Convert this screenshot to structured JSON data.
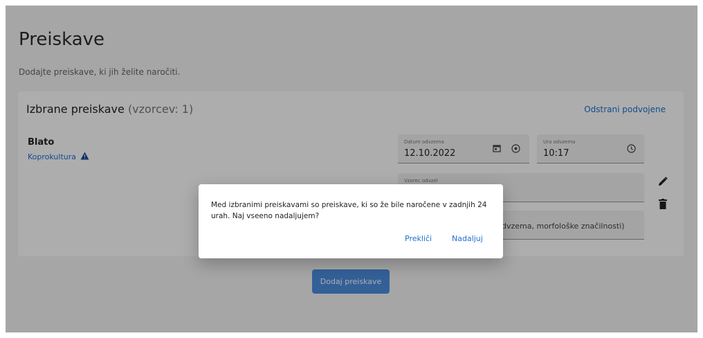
{
  "page": {
    "title": "Preiskave",
    "subtitle": "Dodajte preiskave, ki jih želite naročiti."
  },
  "card": {
    "title": "Izbrane preiskave",
    "count_label": "(vzorcev: 1)",
    "remove_duplicates": "Odstrani podvojene"
  },
  "test": {
    "name": "Blato",
    "subtest": "Koprokultura"
  },
  "fields": {
    "date_label": "Datum odvzema",
    "date_value": "12.10.2022",
    "time_label": "Ura odvzema",
    "time_value": "10:17",
    "sample_label": "Vzorec odvzel",
    "comment_partial": "dvzema, morfološke značilnosti)"
  },
  "add_button": "Dodaj preiskave",
  "dialog": {
    "message": "Med izbranimi preiskavami so preiskave, ki so že bile naročene v zadnjih 24 urah. Naj vseeno nadaljujem?",
    "cancel": "Prekliči",
    "continue": "Nadaljuj"
  },
  "colors": {
    "accent": "#1e6fd0",
    "button": "#4d8ee0",
    "warning": "#1f4d8f"
  },
  "icons": [
    "calendar-icon",
    "radio-icon",
    "clock-icon",
    "pencil-icon",
    "trash-icon",
    "warning-icon"
  ]
}
